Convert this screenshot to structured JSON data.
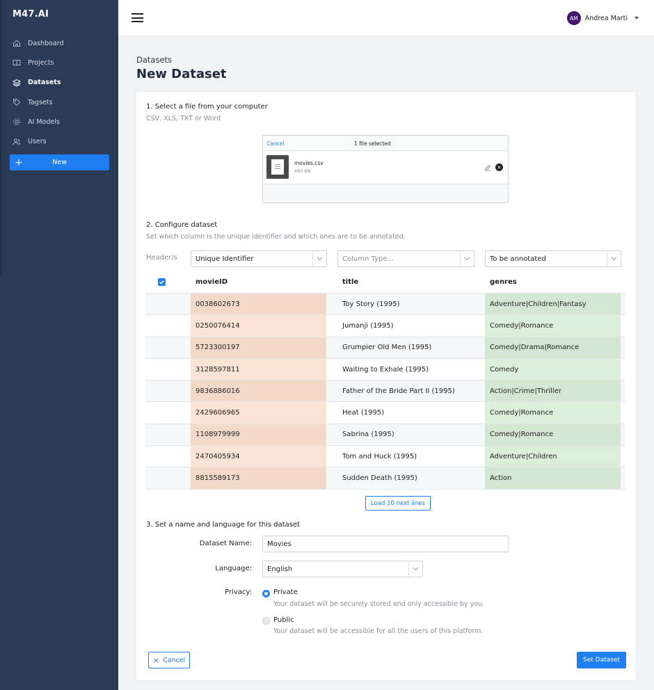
{
  "app": {
    "logo": "M47.AI"
  },
  "sidebar": {
    "items": [
      {
        "label": "Dashboard",
        "icon": "home-icon"
      },
      {
        "label": "Projects",
        "icon": "book-icon"
      },
      {
        "label": "Datasets",
        "icon": "layers-icon",
        "active": true
      },
      {
        "label": "Tagsets",
        "icon": "tag-icon"
      },
      {
        "label": "AI Models",
        "icon": "gear-icon"
      },
      {
        "label": "Users",
        "icon": "users-icon"
      }
    ],
    "new_button": "New"
  },
  "topbar": {
    "user_initials": "AM",
    "user_name": "Andrea Marti"
  },
  "page": {
    "breadcrumb": "Datasets",
    "title": "New Dataset"
  },
  "step1": {
    "title": "1. Select a file from your computer",
    "subtitle": "CSV, XLS, TXT or Word",
    "upload": {
      "cancel": "Cancel",
      "status": "1 file selected",
      "file_name": "movies.csv",
      "file_size": "483 KB"
    }
  },
  "step2": {
    "title": "2. Configure dataset",
    "subtitle": "Set which column is the unique identifier and which ones are to be annotated.",
    "header_label": "Header/s",
    "selects": [
      "Unique Identifier",
      "Column Type...",
      "To be annotated"
    ],
    "columns": [
      "movieID",
      "title",
      "genres"
    ],
    "rows": [
      [
        "0038602673",
        "Toy Story (1995)",
        "Adventure|Children|Fantasy"
      ],
      [
        "0250076414",
        "Jumanji (1995)",
        "Comedy|Romance"
      ],
      [
        "5723300197",
        "Grumpier Old Men (1995)",
        "Comedy|Drama|Romance"
      ],
      [
        "3128597811",
        "Waiting to Exhale (1995)",
        "Comedy"
      ],
      [
        "9836886016",
        "Father of the Bride Part II (1995)",
        "Action|Crime|Thriller"
      ],
      [
        "2429606965",
        "Heat (1995)",
        "Comedy|Romance"
      ],
      [
        "1108979999",
        "Sabrina (1995)",
        "Comedy|Romance"
      ],
      [
        "2470405934",
        "Tom and Huck (1995)",
        "Adventure|Children"
      ],
      [
        "8815589173",
        "Sudden Death (1995)",
        "Action"
      ]
    ],
    "load_more": "Load 10 next lines"
  },
  "step3": {
    "title": "3. Set a name and language for this dataset",
    "name_label": "Dataset Name:",
    "name_value": "Movies",
    "language_label": "Language:",
    "language_value": "English",
    "privacy_label": "Privacy:",
    "private_label": "Private",
    "private_desc": "Your dataset will be securely stored and only accessible by you.",
    "public_label": "Public",
    "public_desc": "Your dataset will be accessible for all the users of this platform."
  },
  "actions": {
    "cancel": "Cancel",
    "submit": "Set Dataset"
  },
  "colors": {
    "sidebar": "#2a3a57",
    "accent": "#1f7ff0",
    "identifier_col": "#fbe4d3",
    "annotated_col": "#dcefdb",
    "avatar": "#44166f"
  }
}
